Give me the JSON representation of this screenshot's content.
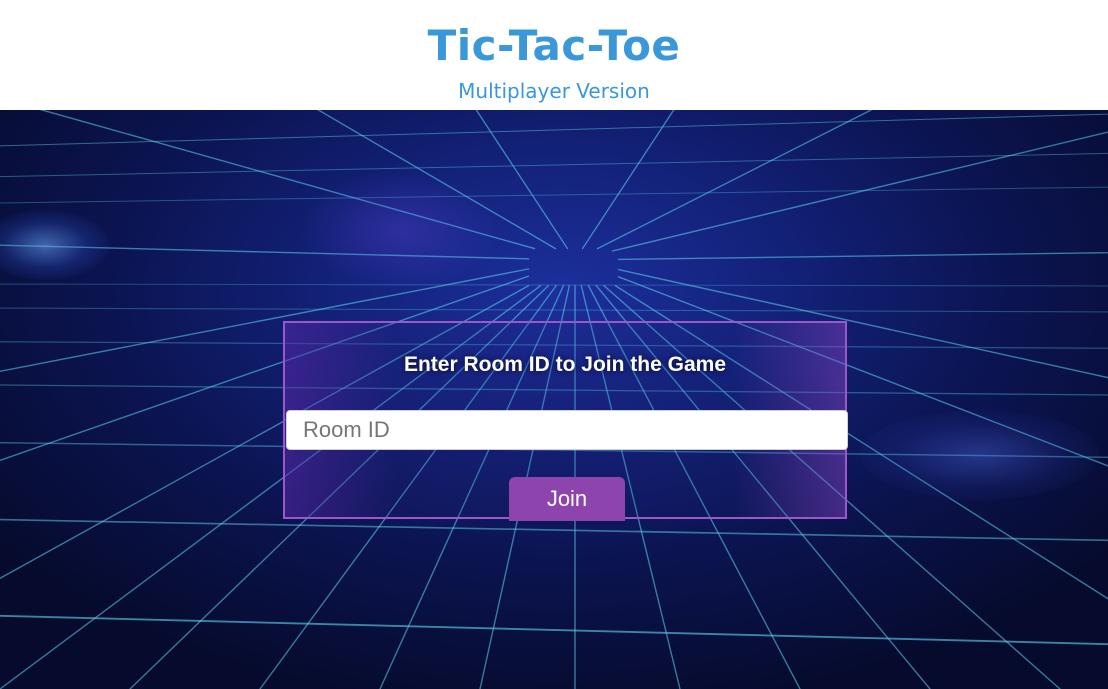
{
  "header": {
    "title": "Tic-Tac-Toe",
    "subtitle": "Multiplayer Version"
  },
  "join_panel": {
    "heading": "Enter Room ID to Join the Game",
    "room_input": {
      "value": "",
      "placeholder": "Room ID"
    },
    "join_button_label": "Join"
  },
  "colors": {
    "title": "#3a97d9",
    "panel_border": "#9b59c8",
    "button": "#8e44ad",
    "grid_line": "#5fd6f0",
    "background": "#0b1450"
  }
}
